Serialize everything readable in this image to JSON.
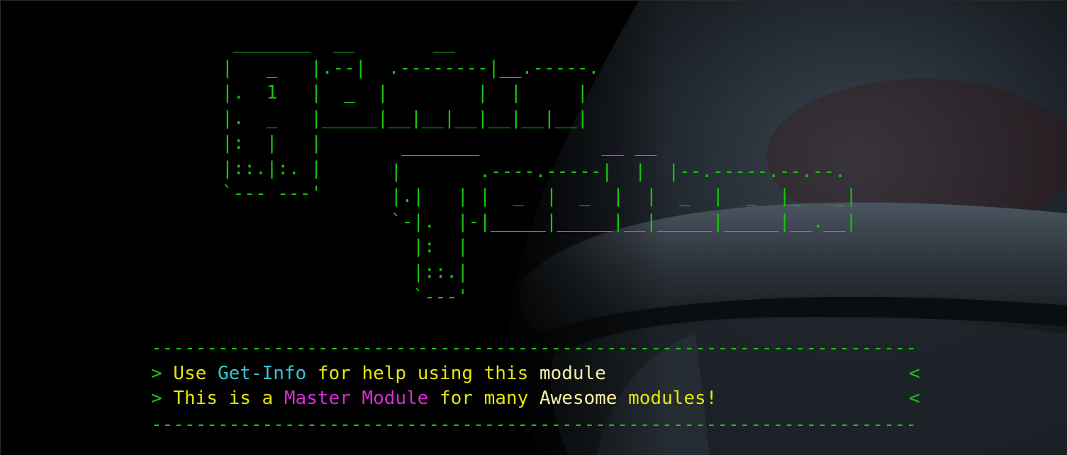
{
  "terminal": {
    "background_color": "#000000",
    "banner_color": "#16c60c",
    "ascii_top": " _______  __       __\n|   _   |.--|  .--------|__.-----.\n|.  1   |  _  |        |  |     |\n|.  _   |_____|__|__|__|__|__|__|\n|:  |   |\n|::.|:. |\n`--- ---'",
    "ascii_bottom": " _______           __ __\n|       .----.-----|  |  |--.-----.--.--.\n|.|   | |  _  |  _  |  |  _  |  _  |_   _|\n`-|.  |-|_____|_____|__|_____|_____|__.__|\n  |:  |\n  |::.|\n  `---'",
    "divider": "-------------------------------------------------------------------------",
    "lines": [
      {
        "prompt": ">",
        "parts": [
          {
            "text": " Use ",
            "color": "#e5e510"
          },
          {
            "text": "Get-Info",
            "color": "#3ac3d3"
          },
          {
            "text": " for help using this ",
            "color": "#e5e510"
          },
          {
            "text": "module",
            "color": "#f9f1a5"
          }
        ],
        "end_mark": "<"
      },
      {
        "prompt": ">",
        "parts": [
          {
            "text": " This is a ",
            "color": "#e5e510"
          },
          {
            "text": "Master Module",
            "color": "#d42fd4"
          },
          {
            "text": " for many ",
            "color": "#e5e510"
          },
          {
            "text": "Awesome",
            "color": "#f9f1a5"
          },
          {
            "text": " modules!",
            "color": "#e5e510"
          }
        ],
        "end_mark": "<"
      }
    ]
  }
}
